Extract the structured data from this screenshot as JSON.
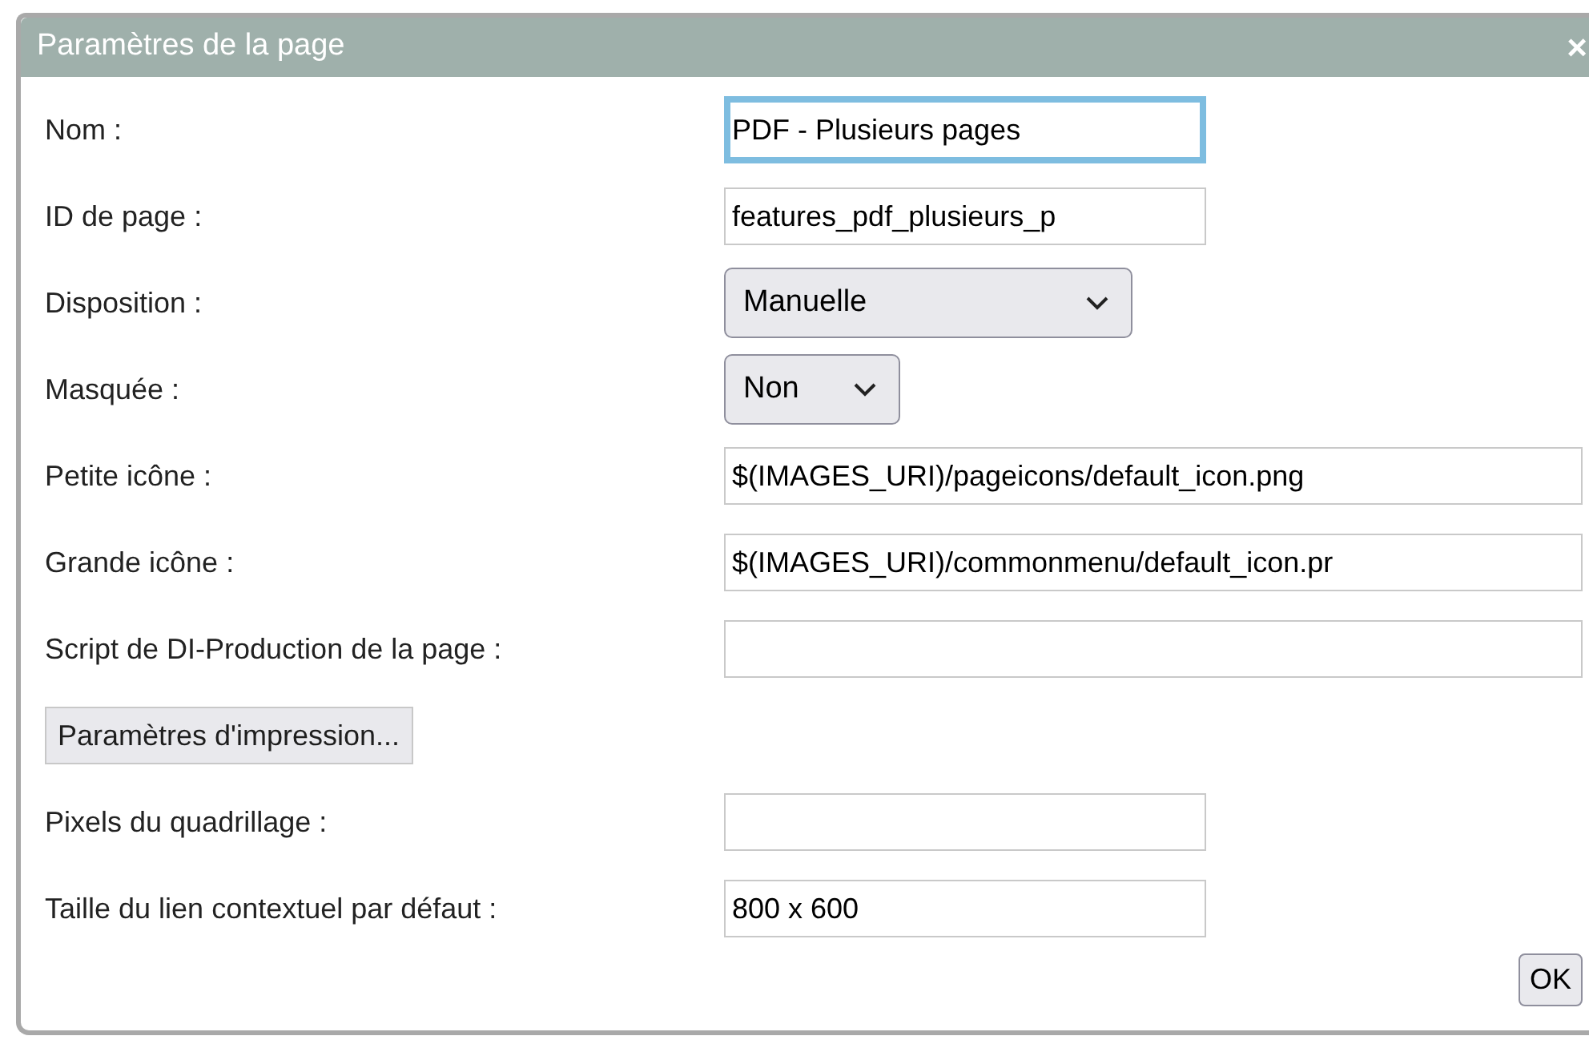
{
  "dialog": {
    "title": "Paramètres de la page",
    "close": "×"
  },
  "rows": [
    {
      "kind": "text",
      "label": "Nom :",
      "value": "PDF - Plusieurs pages",
      "focused": true
    },
    {
      "kind": "text",
      "label": "ID de page :",
      "value": "features_pdf_plusieurs_p",
      "focused": false
    },
    {
      "kind": "select",
      "label": "Disposition :",
      "value": "Manuelle"
    },
    {
      "kind": "select",
      "label": "Masquée :",
      "value": "Non"
    },
    {
      "kind": "text",
      "label": "Petite icône :",
      "value": "$(IMAGES_URI)/pageicons/default_icon.png",
      "focused": false
    },
    {
      "kind": "text",
      "label": "Grande icône :",
      "value": "$(IMAGES_URI)/commonmenu/default_icon.pr",
      "focused": false
    },
    {
      "kind": "text",
      "label": "Script de DI-Production de la page :",
      "focused": false
    },
    {
      "kind": "button",
      "label": "Paramètres d'impression..."
    },
    {
      "kind": "text",
      "label": "Pixels du quadrillage :",
      "focused": false
    },
    {
      "kind": "text",
      "label": "Taille du lien contextuel par défaut :",
      "value": "800 x 600",
      "focused": false
    }
  ],
  "ok_button": "OK"
}
